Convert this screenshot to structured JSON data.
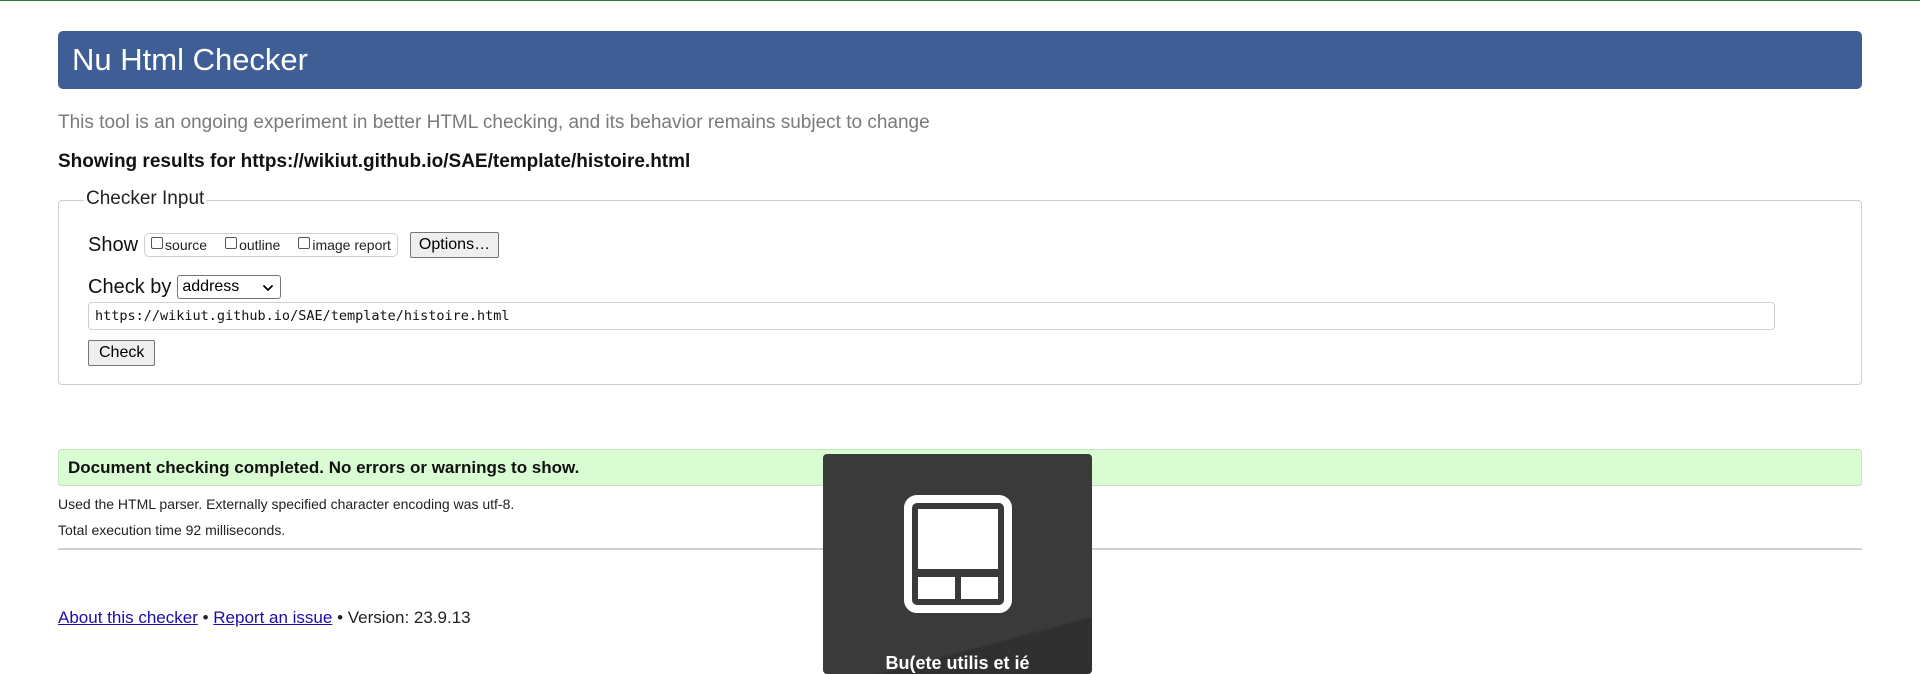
{
  "header": {
    "title": "Nu Html Checker"
  },
  "intro_text": "This tool is an ongoing experiment in better HTML checking, and its behavior remains subject to change",
  "results_for": "Showing results for https://wikiut.github.io/SAE/template/histoire.html",
  "checker_input": {
    "legend": "Checker Input",
    "show_label": "Show",
    "show_options": [
      {
        "label": "source",
        "checked": false
      },
      {
        "label": "outline",
        "checked": false
      },
      {
        "label": "image report",
        "checked": false
      }
    ],
    "options_button": "Options…",
    "check_by_label": "Check by",
    "check_by_value": "address",
    "url_value": "https://wikiut.github.io/SAE/template/histoire.html",
    "check_button": "Check"
  },
  "result": {
    "success_message": "Document checking completed. No errors or warnings to show.",
    "parser_note": "Used the HTML parser. Externally specified character encoding was utf-8.",
    "execution_time": "Total execution time 92 milliseconds."
  },
  "footer": {
    "about_link": "About this checker",
    "separator": " • ",
    "report_link": "Report an issue",
    "version": "Version: 23.9.13"
  },
  "overlay": {
    "icon": "tablet-layout-icon",
    "caption": "Bu(ete utilis et ié"
  },
  "colors": {
    "header_bg": "#3e5e95",
    "success_bg": "#d9fcd3",
    "link": "#1a0dab",
    "overlay_bg": "#3a3a3a"
  }
}
